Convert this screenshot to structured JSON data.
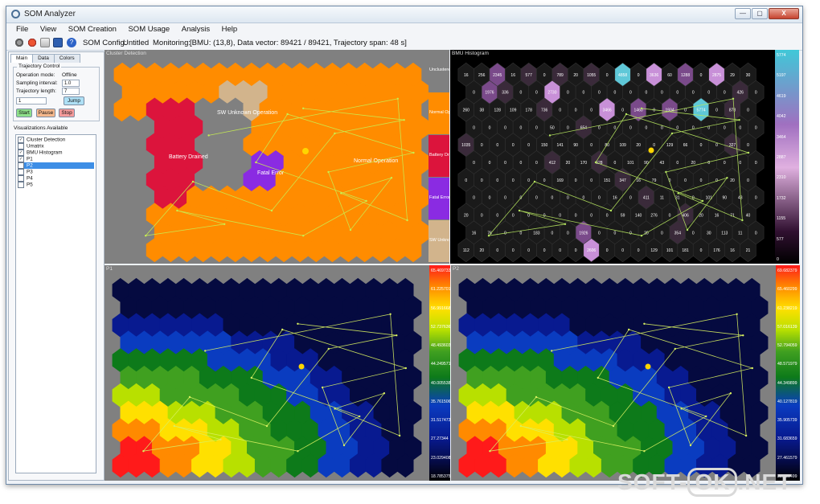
{
  "window": {
    "title": "SOM Analyzer",
    "controls": [
      "—",
      "▢",
      "X"
    ]
  },
  "menu": [
    "File",
    "View",
    "SOM Creation",
    "SOM Usage",
    "Analysis",
    "Help"
  ],
  "toolbar": {
    "icons": [
      "gear-icon",
      "bug-icon",
      "open-folder-icon",
      "save-icon",
      "help-icon"
    ],
    "som_config_label": "SOM Config:",
    "som_config_value": "Untitled",
    "monitoring_label": "Monitoring:",
    "monitoring_value": "[BMU: (13,8), Data vector: 89421 / 89421, Trajectory span: 48 s]"
  },
  "left": {
    "tabs": [
      "Main",
      "Data",
      "Colors"
    ],
    "trajectory": {
      "title": "Trajectory Control",
      "operation_mode_label": "Operation mode:",
      "operation_mode_value": "Offline",
      "sampling_label": "Sampling interval:",
      "sampling_value": "1.0",
      "length_label": "Trajectory length:",
      "length_value": "7",
      "jump_input": "1",
      "jump": "Jump",
      "start": "Start",
      "pause": "Pause",
      "stop": "Stop"
    },
    "viz": {
      "title": "Visualizations Available",
      "items": [
        {
          "label": "Cluster Detection",
          "checked": true
        },
        {
          "label": "Umatrix",
          "checked": false
        },
        {
          "label": "BMU Histogram",
          "checked": true
        },
        {
          "label": "P1",
          "checked": true
        },
        {
          "label": "P2",
          "checked": true,
          "selected": true
        },
        {
          "label": "P3",
          "checked": false
        },
        {
          "label": "P4",
          "checked": false
        },
        {
          "label": "P5",
          "checked": false
        }
      ]
    }
  },
  "panels": {
    "cluster": {
      "title": "Cluster Detection",
      "labels": [
        "SW Unknown Operation",
        "Battery Drained",
        "Fatal Error",
        "Normal Operation"
      ],
      "legend": [
        "Unclustered",
        "Normal Op",
        "Battery Dra",
        "Fatal Error",
        "SW Unknow"
      ],
      "colors": {
        "normal": "#ff8c00",
        "battery": "#dc143c",
        "fatal": "#8a2be2",
        "unknown": "#d2b48c",
        "unclustered": "#808080"
      }
    },
    "bmu": {
      "title": "BMU Histogram",
      "scale": [
        "5774",
        "5197",
        "4619",
        "4042",
        "3464",
        "2887",
        "2310",
        "1732",
        "1155",
        "577",
        "0"
      ],
      "numbers": [
        "16",
        "256",
        "2345",
        "16",
        "577",
        "0",
        "789",
        "20",
        "1055",
        "0",
        "4858",
        "0",
        "3636",
        "60",
        "1288",
        "0",
        "2875",
        "29",
        "30",
        "0",
        "1976",
        "336",
        "0",
        "0",
        "2730",
        "0",
        "0",
        "0",
        "0",
        "0",
        "0",
        "0",
        "0",
        "0",
        "0",
        "0",
        "426",
        "0",
        "260",
        "38",
        "128",
        "109",
        "178",
        "736",
        "0",
        "0",
        "0",
        "3466",
        "0",
        "1460",
        "0",
        "1934",
        "0",
        "5774",
        "0",
        "878",
        "0",
        "0",
        "0",
        "0",
        "0",
        "0",
        "50",
        "0",
        "654",
        "0",
        "0",
        "0",
        "0",
        "0",
        "0",
        "0",
        "0",
        "0",
        "0",
        "0",
        "1035",
        "0",
        "0",
        "0",
        "0",
        "150",
        "141",
        "90",
        "0",
        "80",
        "109",
        "20",
        "0",
        "129",
        "66",
        "0",
        "0",
        "327",
        "0",
        "0",
        "0",
        "0",
        "0",
        "0",
        "412",
        "20",
        "170",
        "528",
        "0",
        "101",
        "90",
        "43",
        "0",
        "20",
        "0",
        "0",
        "0",
        "0",
        "0",
        "0",
        "0",
        "0",
        "0",
        "0",
        "169",
        "0",
        "0",
        "151",
        "347",
        "16",
        "79",
        "0",
        "0",
        "0",
        "0",
        "20",
        "0",
        "0",
        "0",
        "0",
        "0",
        "0",
        "0",
        "0",
        "0",
        "0",
        "16",
        "0",
        "411",
        "11",
        "31",
        "0",
        "101",
        "90",
        "43",
        "0",
        "20",
        "0",
        "0",
        "0",
        "0",
        "0",
        "0",
        "0",
        "0",
        "0",
        "59",
        "140",
        "276",
        "0",
        "406",
        "20",
        "16",
        "71",
        "40",
        "16",
        "76",
        "0",
        "0",
        "183",
        "0",
        "0",
        "1926",
        "0",
        "0",
        "0",
        "20",
        "0",
        "354",
        "0",
        "30",
        "113",
        "11",
        "0",
        "112",
        "20",
        "0",
        "0",
        "0",
        "0",
        "0",
        "0",
        "2606",
        "0",
        "0",
        "0",
        "129",
        "101",
        "181",
        "0",
        "176",
        "16",
        "21",
        "80",
        "0",
        "152",
        "0",
        "380",
        "29",
        "0",
        "0",
        "3826",
        "0",
        "2574",
        "0",
        "0",
        "100",
        "0",
        "0",
        "404",
        "0",
        "0",
        "0",
        "0",
        "0",
        "0",
        "0",
        "0",
        "0",
        "0",
        "0",
        "0",
        "0",
        "0",
        "0",
        "0",
        "0",
        "200",
        "179",
        "0",
        "0",
        "0",
        "127",
        "109",
        "96",
        "297",
        "302",
        "390",
        "0",
        "0",
        "0",
        "0",
        "0",
        "0",
        "0",
        "0",
        "0",
        "71",
        "0",
        "0",
        "0",
        "0",
        "0",
        "0",
        "0",
        "0",
        "0",
        "0",
        "0",
        "0",
        "0",
        "0",
        "0",
        "0",
        "0",
        "0",
        "1654",
        "0",
        "248",
        "0",
        "363",
        "0",
        "0",
        "0",
        "0",
        "284",
        "0",
        "156",
        "215",
        "0",
        "921",
        "0",
        "0",
        "0",
        "0",
        "0",
        "0",
        "0",
        "0",
        "350",
        "199",
        "0",
        "0",
        "0",
        "0",
        "0",
        "0",
        "0",
        "0",
        "0",
        "0",
        "0",
        "2857",
        "0",
        "0",
        "0",
        "0",
        "0",
        "0",
        "847",
        "176",
        "271",
        "20",
        "769",
        "0",
        "219",
        "199",
        "145",
        "158",
        "0",
        "278",
        "70",
        "887",
        "70",
        "1639",
        "0",
        "4022",
        "0",
        "80",
        "21",
        "0"
      ]
    },
    "p1": {
      "title": "P1",
      "scale": [
        "65.469733",
        "61.225701",
        "56.991668",
        "52.737636",
        "48.493603",
        "44.249571",
        "40.005538",
        "35.761506",
        "31.517473",
        "27.27344",
        "23.029408",
        "18.785375"
      ]
    },
    "p2": {
      "title": "P2",
      "scale": [
        "69.682379",
        "65.460299",
        "61.238219",
        "57.016139",
        "52.794059",
        "48.571979",
        "44.349899",
        "40.127819",
        "35.905739",
        "31.683659",
        "27.461579",
        "23.239499"
      ]
    }
  },
  "watermark": {
    "left": "SOFT-",
    "box": "OK",
    "right": ".NET"
  }
}
